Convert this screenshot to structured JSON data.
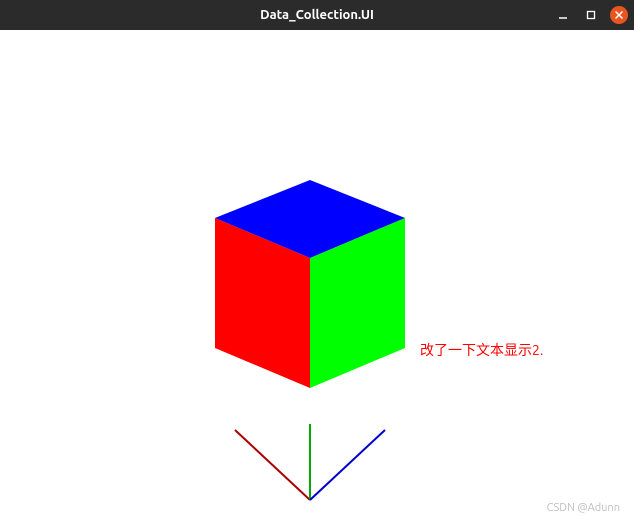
{
  "window": {
    "title": "Data_Collection.UI"
  },
  "viewport": {
    "annotation_text": "改了一下文本显示2.",
    "annotation_color": "#ef2929",
    "cube_faces": {
      "top": "#0000ff",
      "left": "#ff0000",
      "right": "#00ff00"
    },
    "axis": {
      "x_color": "#aa0000",
      "y_color": "#00aa00",
      "z_color": "#0000cc"
    }
  },
  "watermark": "CSDN @Adunn"
}
